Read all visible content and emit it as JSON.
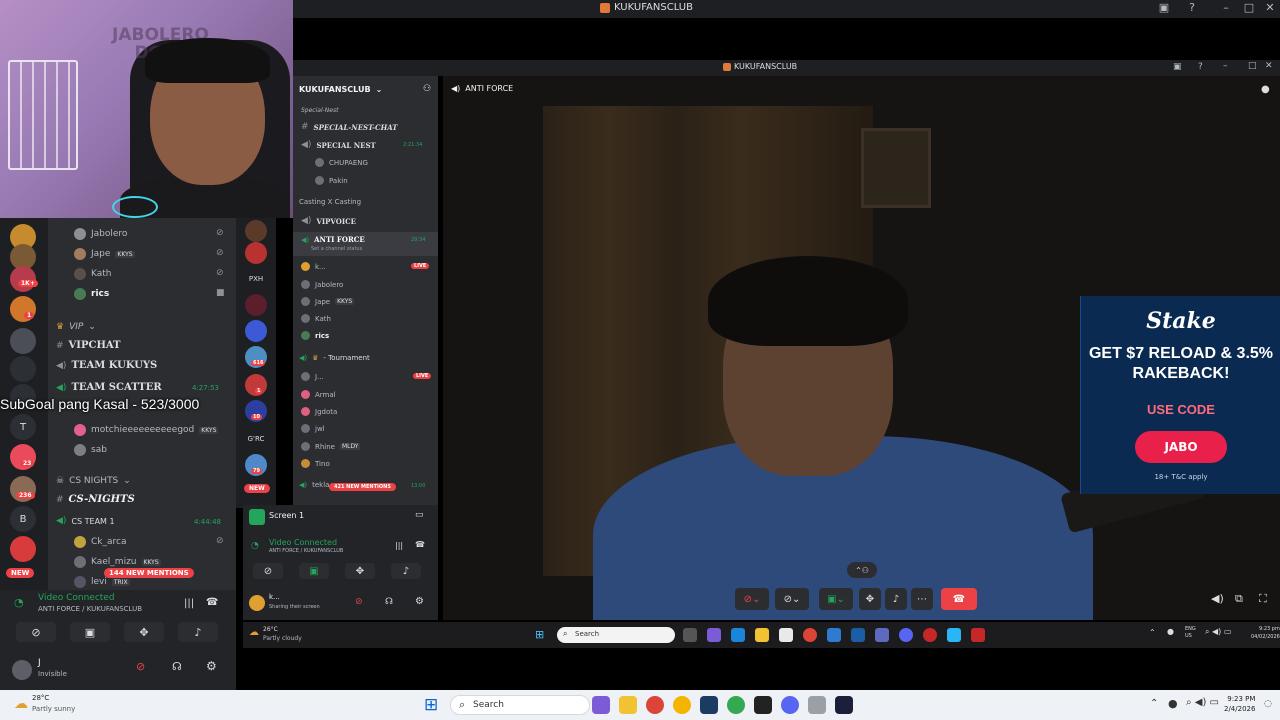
{
  "outer_window": {
    "title": "KUKUFANSCLUB"
  },
  "webcam": {
    "watermark_line1": "JABOLERO",
    "watermark_line2": "DOTA"
  },
  "overlay": {
    "subgoal": "SubGoal pang Kasal - 523/3000"
  },
  "left_channels": {
    "members_top": [
      "Jabolero",
      "Jape",
      "Kath",
      "rics"
    ],
    "jape_tag": "KKYS",
    "vip_category": "VIP",
    "vipchat": "VIPCHAT",
    "team_kukuys": "TEAM KUKUYS",
    "team_scatter": "TEAM SCATTER",
    "team_scatter_time": "4:27:53",
    "members_scatter": [
      "motchieeeeeeeeeegod",
      "sab"
    ],
    "motchie_tag": "KKYS",
    "cs_category": "CS NIGHTS",
    "cs_nights": "CS-NIGHTS",
    "cs_team": "CS TEAM 1",
    "cs_team_time": "4:44:48",
    "members_cs": [
      "Ck_arca",
      "Kael_mizu",
      "levi"
    ],
    "kael_tag": "KKYS",
    "levi_tag": "TRIX",
    "new_mentions": "144 NEW MENTIONS",
    "new_badge": "NEW"
  },
  "left_voice": {
    "status": "Video Connected",
    "location": "ANTI FORCE / KUKUFANSCLUB",
    "user": "J",
    "user_status": "Invisible"
  },
  "left_server_badges": [
    "1K+",
    "1",
    "23",
    "236"
  ],
  "left_server_letters": [
    "T",
    "B"
  ],
  "mid_servers": {
    "pxh": "PXH",
    "grc": "G'RC",
    "new": "NEW"
  },
  "mid_server_badges": [
    "616",
    "1",
    "10",
    "79"
  ],
  "inner_window": {
    "title": "KUKUFANSCLUB",
    "video_channel": "ANTI FORCE"
  },
  "inner_channels": {
    "server": "KUKUFANSCLUB",
    "special_nest_cat": "Special-Nest",
    "special_nest_chat": "SPECIAL-NEST-CHAT",
    "special_nest": "SPECIAL NEST",
    "special_nest_time": "2:21:34",
    "special_members": [
      "CHUPAENG",
      "Pakin"
    ],
    "casting_cat": "Casting X Casting",
    "vipvoice": "VIPVOICE",
    "anti_force": "ANTI FORCE",
    "anti_force_time": "29:34",
    "channel_status": "Set a channel status",
    "anti_members": [
      "k...",
      "Jabolero",
      "Jape",
      "Kath",
      "rics"
    ],
    "jape_tag": "KKYS",
    "live": "LIVE",
    "tournament": "- Tournament",
    "tournament_members": [
      "J...",
      "Armal",
      "Jgdota",
      "jwl",
      "Rhine",
      "Tino"
    ],
    "rhine_tag": "MLDY",
    "tekla": "tekla",
    "tekla_time": "13:00",
    "new_mentions": "421 NEW MENTIONS",
    "screen": "Screen 1",
    "voice_status": "Video Connected",
    "voice_location": "ANTI FORCE / KUKUFANSCLUB",
    "user": "k...",
    "user_status": "Sharing their screen"
  },
  "ad": {
    "brand": "Stake",
    "headline": "GET $7 RELOAD & 3.5% RAKEBACK!",
    "code_label": "USE CODE",
    "button": "JABO",
    "terms": "18+ T&C apply"
  },
  "inner_taskbar": {
    "temp": "26°C",
    "weather": "Partly cloudy",
    "search": "Search",
    "lang1": "ENG",
    "lang2": "US",
    "time": "9:23 pm",
    "date": "04/02/2026"
  },
  "taskbar": {
    "temp": "28°C",
    "weather": "Partly sunny",
    "search": "Search",
    "time": "9:23 PM",
    "date": "2/4/2026"
  },
  "colors": {
    "discord_bg": "#2b2d31",
    "discord_dark": "#1e1f22",
    "live_red": "#ed4245",
    "connected_green": "#23a55a",
    "stake_blue": "#0b2a52",
    "stake_button": "#e8204a"
  }
}
